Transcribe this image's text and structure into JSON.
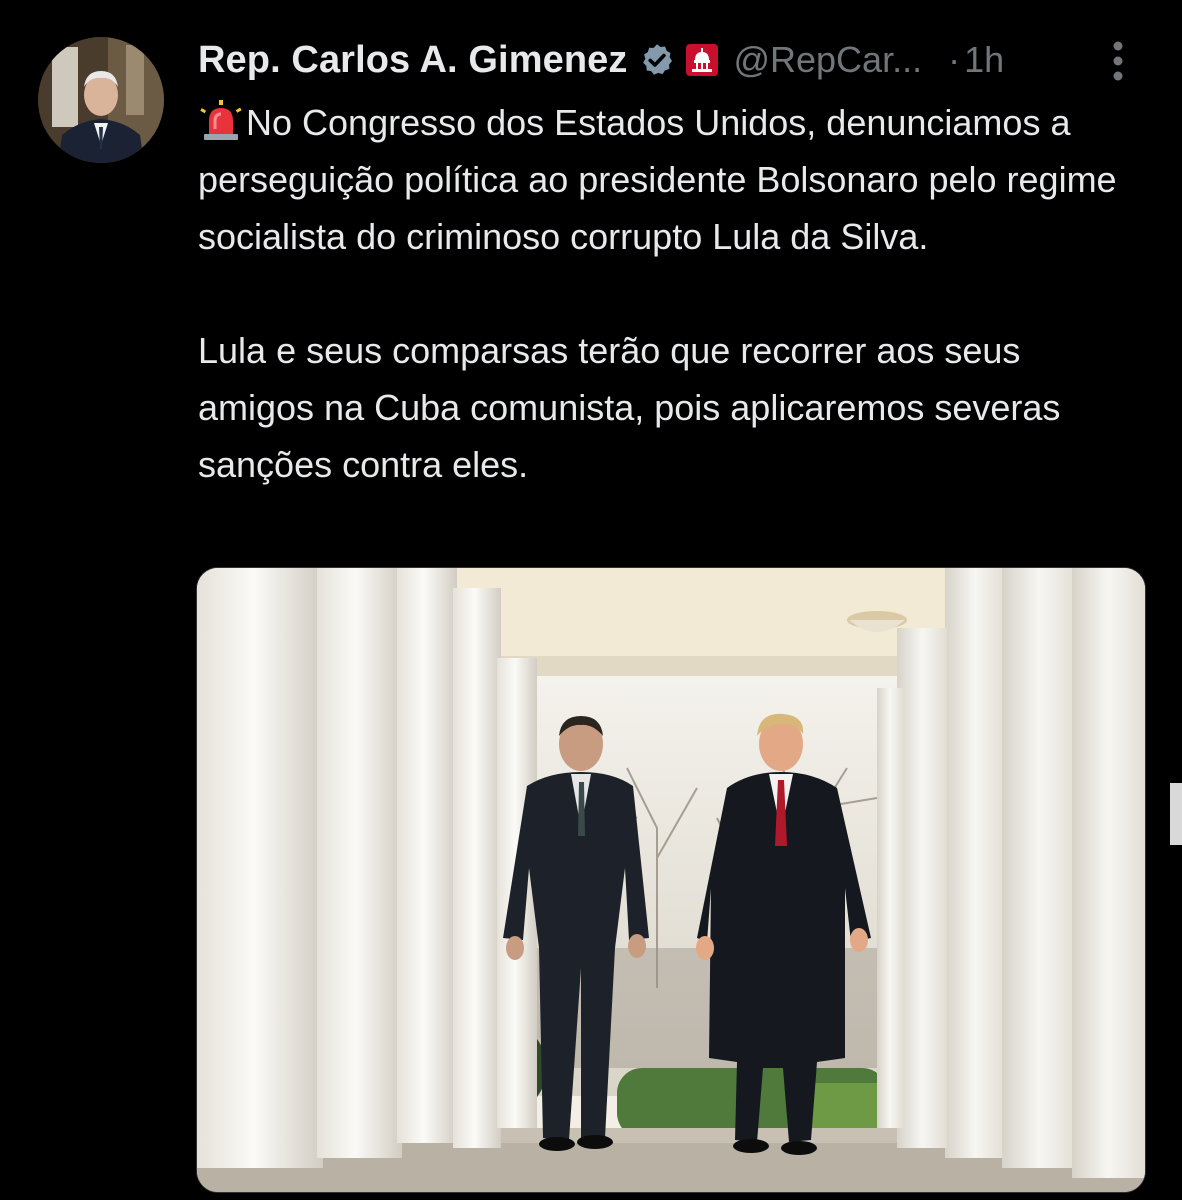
{
  "tweet": {
    "author": {
      "display_name": "Rep. Carlos A. Gimenez",
      "handle": "@RepCar...",
      "avatar_icon": "person-portrait-avatar",
      "verified_icon": "verified-badge-icon",
      "affiliation_icon": "us-capitol-badge-icon"
    },
    "separator": "·",
    "timestamp": "1h",
    "more_icon": "more-vertical-icon",
    "text": {
      "emoji": "rotating-light-siren-icon",
      "paragraph_1": "No Congresso dos Estados Unidos, denunciamos a perseguição política ao presidente Bolsonaro pelo regime socialista do criminoso corrupto Lula da Silva.",
      "paragraph_2": "Lula e seus comparsas terão que recorrer aos seus amigos na Cuba comunista, pois aplicaremos severas sanções contra eles."
    },
    "media": {
      "type": "photo",
      "subject": "two-men-walking-colonnade-photo"
    }
  },
  "colors": {
    "background": "#000000",
    "text_primary": "#e7e9ea",
    "text_secondary": "#71767b",
    "verified": "#829aab",
    "affiliation_badge": "#c8102e",
    "border": "#2f3336"
  }
}
